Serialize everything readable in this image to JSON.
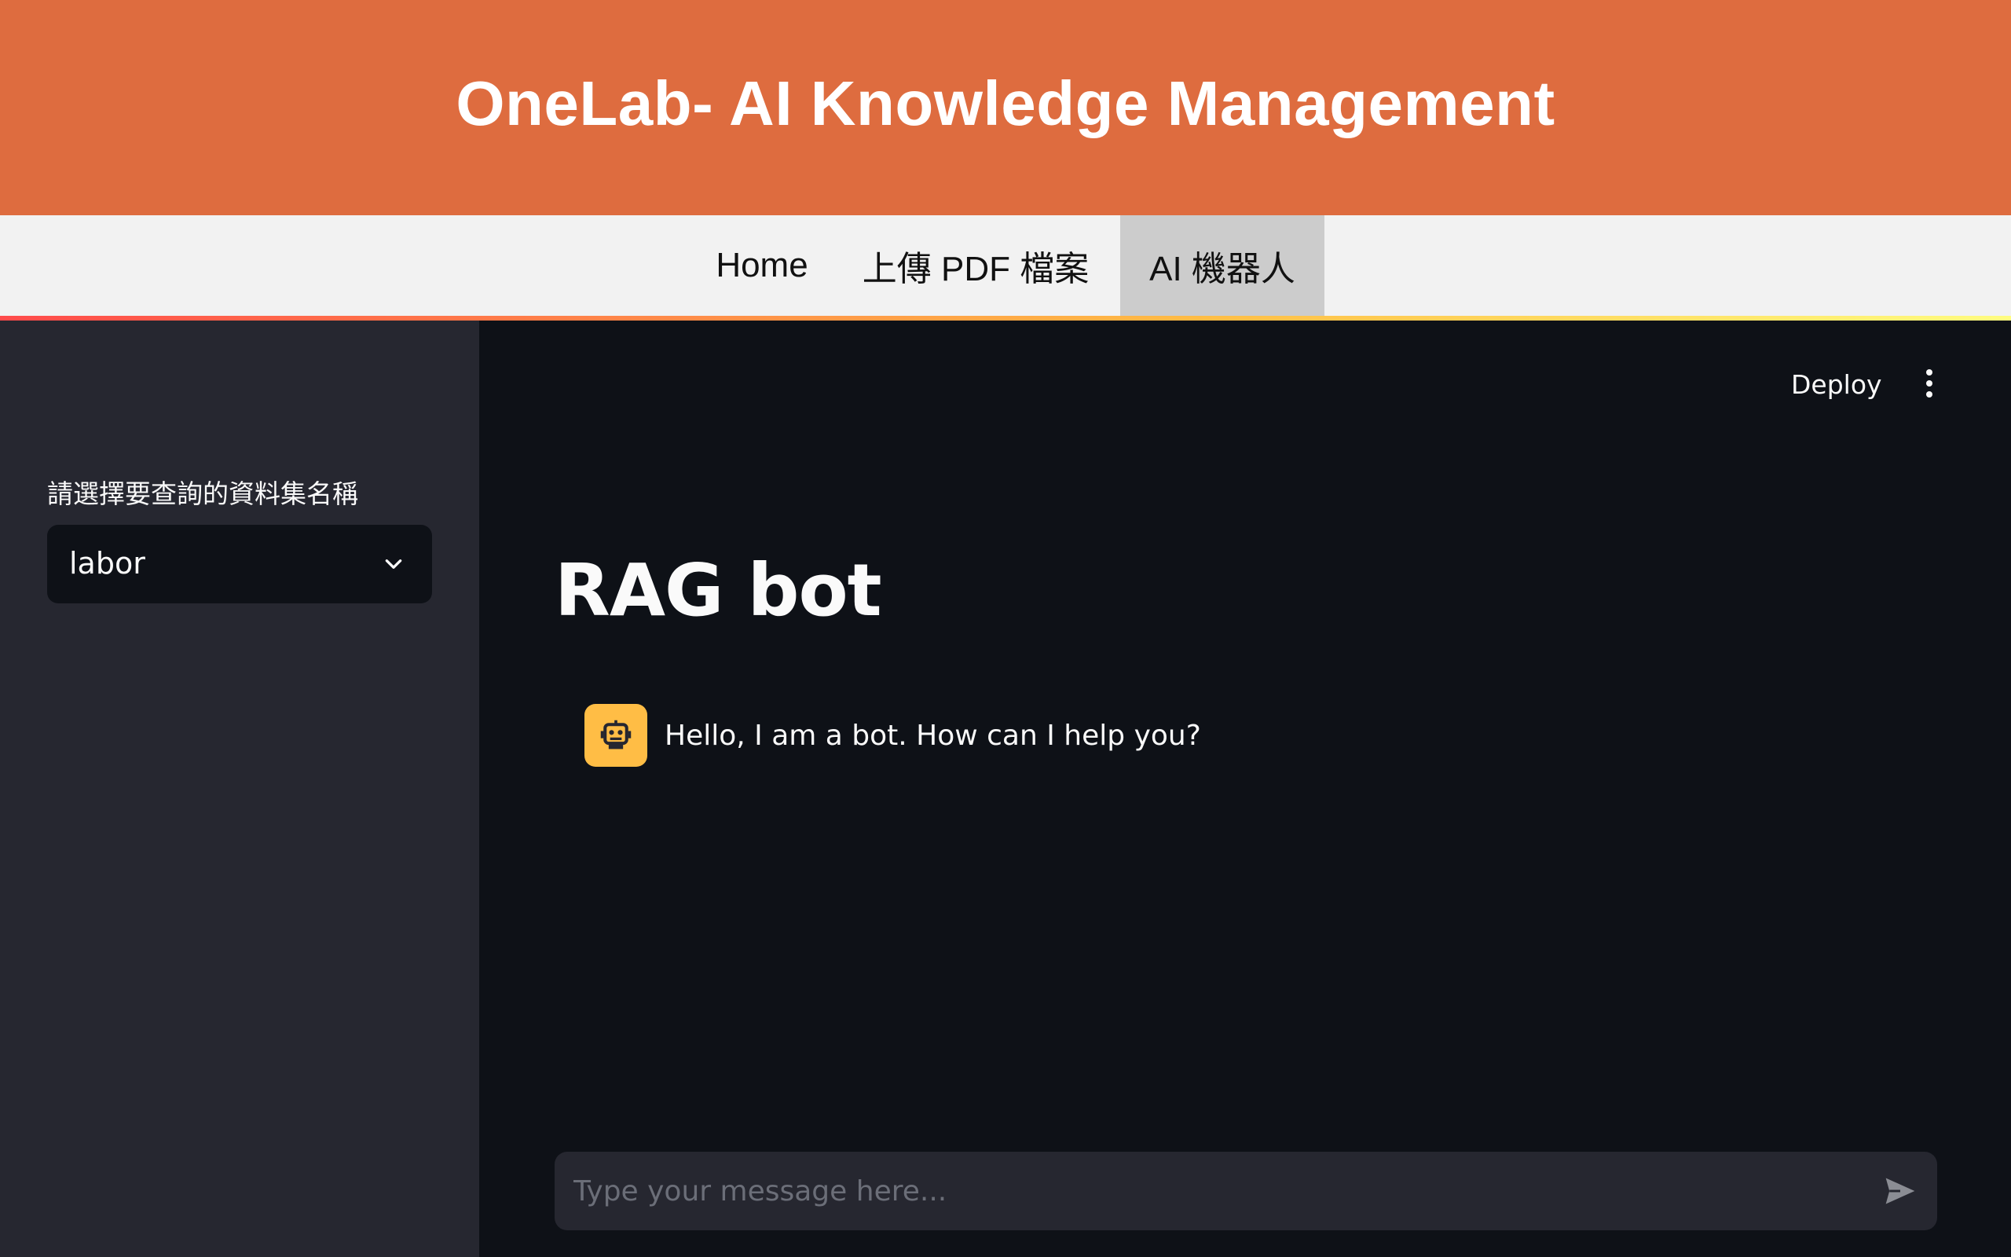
{
  "header": {
    "title": "OneLab- AI Knowledge Management"
  },
  "nav": {
    "items": [
      {
        "label": "Home"
      },
      {
        "label": "上傳 PDF 檔案"
      },
      {
        "label": "AI 機器人",
        "active": true
      }
    ]
  },
  "sidebar": {
    "dataset_label": "請選擇要查詢的資料集名稱",
    "dataset_selected": "labor"
  },
  "toolbar": {
    "deploy_label": "Deploy",
    "menu_icon": "vertical-dots-icon"
  },
  "main": {
    "title": "RAG bot",
    "messages": [
      {
        "role": "assistant",
        "avatar_icon": "robot-icon",
        "text": "Hello, I am a bot. How can I help you?"
      }
    ]
  },
  "chat_input": {
    "placeholder": "Type your message here...",
    "value": "",
    "send_icon": "send-icon"
  },
  "colors": {
    "header_bg": "#de6c3f",
    "nav_bg": "#f2f2f2",
    "nav_active_bg": "#cccccc",
    "sidebar_bg": "#262730",
    "main_bg": "#0e1117",
    "avatar_bg": "#ffbd45"
  }
}
